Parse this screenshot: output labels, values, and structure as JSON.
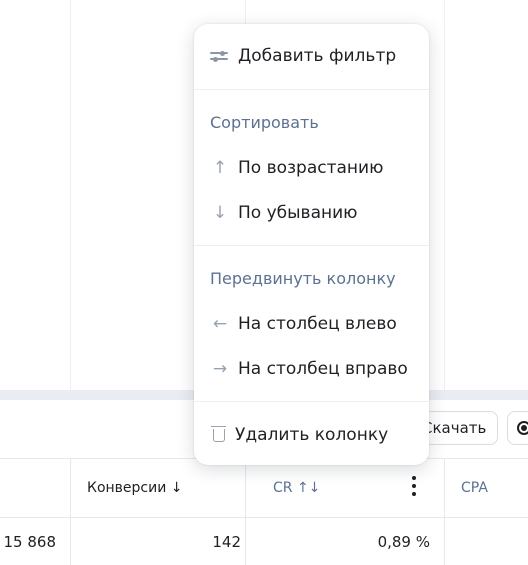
{
  "menu": {
    "add_filter": {
      "label": "Добавить фильтр",
      "icon": "filter-sliders-icon"
    },
    "sort_section": "Сортировать",
    "sort_asc": {
      "label": "По возрастанию",
      "icon": "↑"
    },
    "sort_desc": {
      "label": "По убыванию",
      "icon": "↓"
    },
    "move_section": "Передвинуть колонку",
    "move_left": {
      "label": "На столбец влево",
      "icon": "←"
    },
    "move_right": {
      "label": "На столбец вправо",
      "icon": "→"
    },
    "delete_column": {
      "label": "Удалить колонку",
      "icon": "trash-icon"
    }
  },
  "toolbar": {
    "download_label": "Скачать",
    "settings_icon": "gear-icon"
  },
  "table": {
    "columns": [
      "Конверсии ↓",
      "CR ↑↓",
      "CPA"
    ],
    "row": [
      "15 868",
      "142",
      "0,89 %",
      ""
    ]
  },
  "colors": {
    "accent_text": "#5b7196",
    "divider_band": "#e9edf3"
  }
}
